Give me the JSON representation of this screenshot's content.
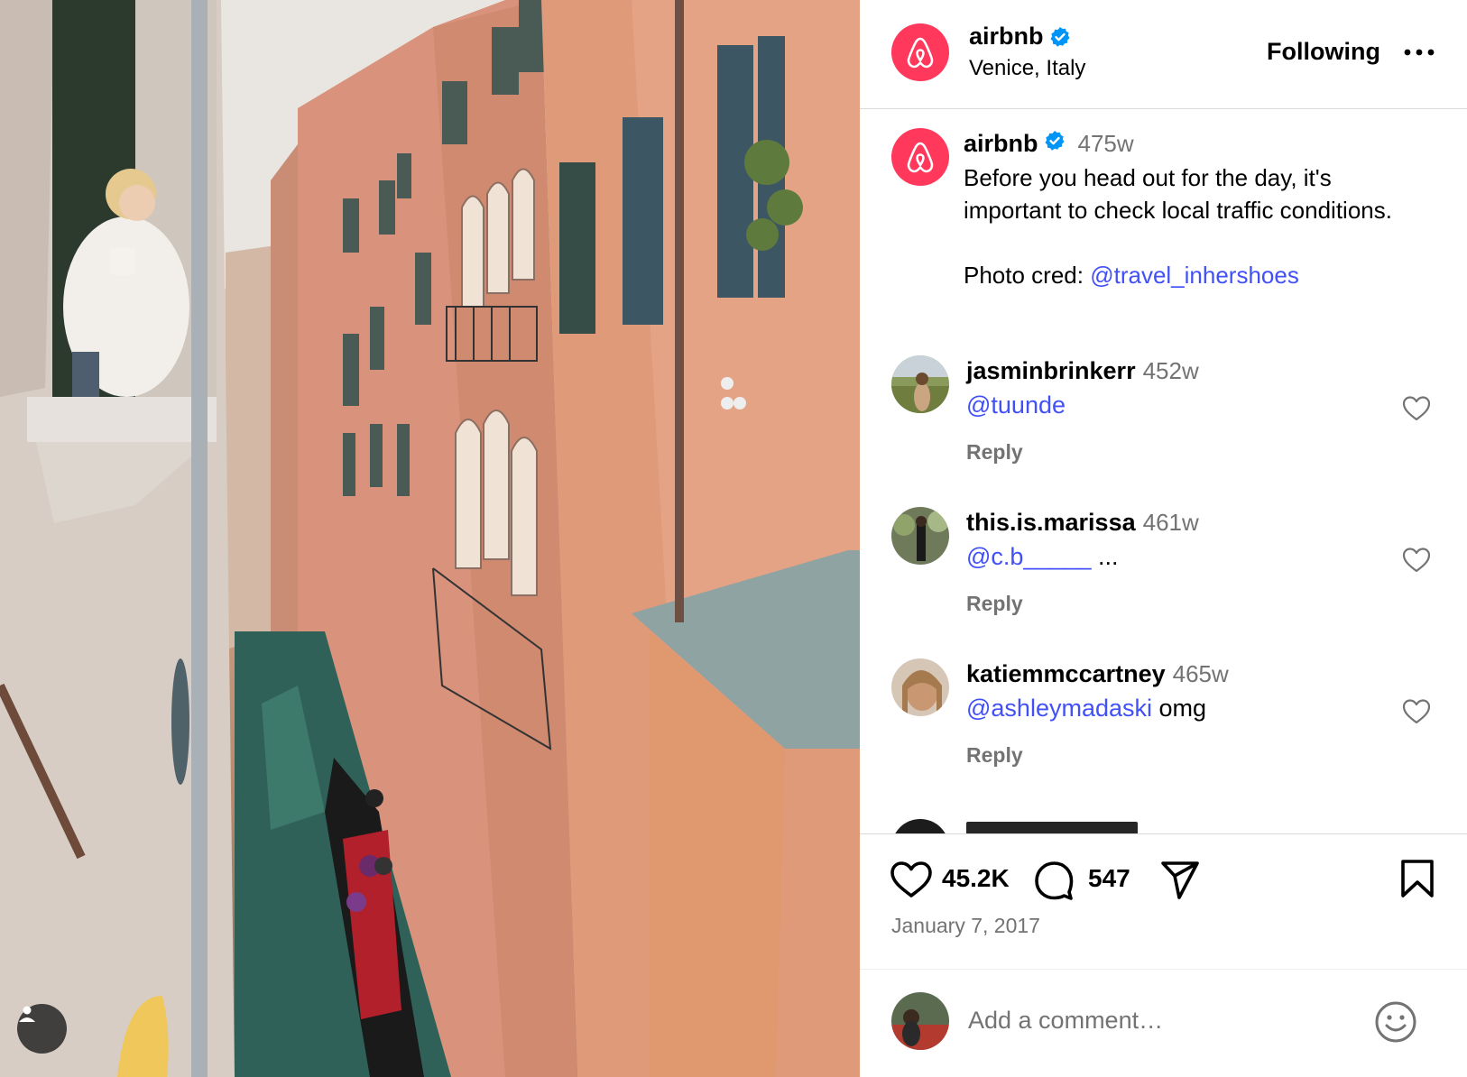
{
  "post": {
    "author": "airbnb",
    "location": "Venice, Italy",
    "follow_state": "Following",
    "caption": {
      "username": "airbnb",
      "age": "475w",
      "line1": "Before you head out for the day, it's important to check local traffic conditions.",
      "credit_prefix": "Photo cred: ",
      "credit_mention": "@travel_inhershoes"
    },
    "likes": "45.2K",
    "comments_count": "547",
    "date": "January 7, 2017"
  },
  "comments": [
    {
      "username": "jasminbrinkerr",
      "age": "452w",
      "mention": "@tuunde",
      "text": "",
      "reply": "Reply"
    },
    {
      "username": "this.is.marissa",
      "age": "461w",
      "mention": "@c.b_____",
      "text": " ...",
      "reply": "Reply"
    },
    {
      "username": "katiemmccartney",
      "age": "465w",
      "mention": "@ashleymadaski",
      "text": " omg",
      "reply": "Reply"
    }
  ],
  "composer": {
    "placeholder": "Add a comment…"
  },
  "colors": {
    "brand": "#ff385c",
    "link": "#4150f7",
    "muted": "#737373",
    "verified": "#0095f6"
  },
  "icons": [
    "airbnb-logo-icon",
    "verified-badge-icon",
    "more-icon",
    "heart-icon",
    "comment-icon",
    "share-icon",
    "bookmark-icon",
    "emoji-icon",
    "user-tag-icon"
  ]
}
